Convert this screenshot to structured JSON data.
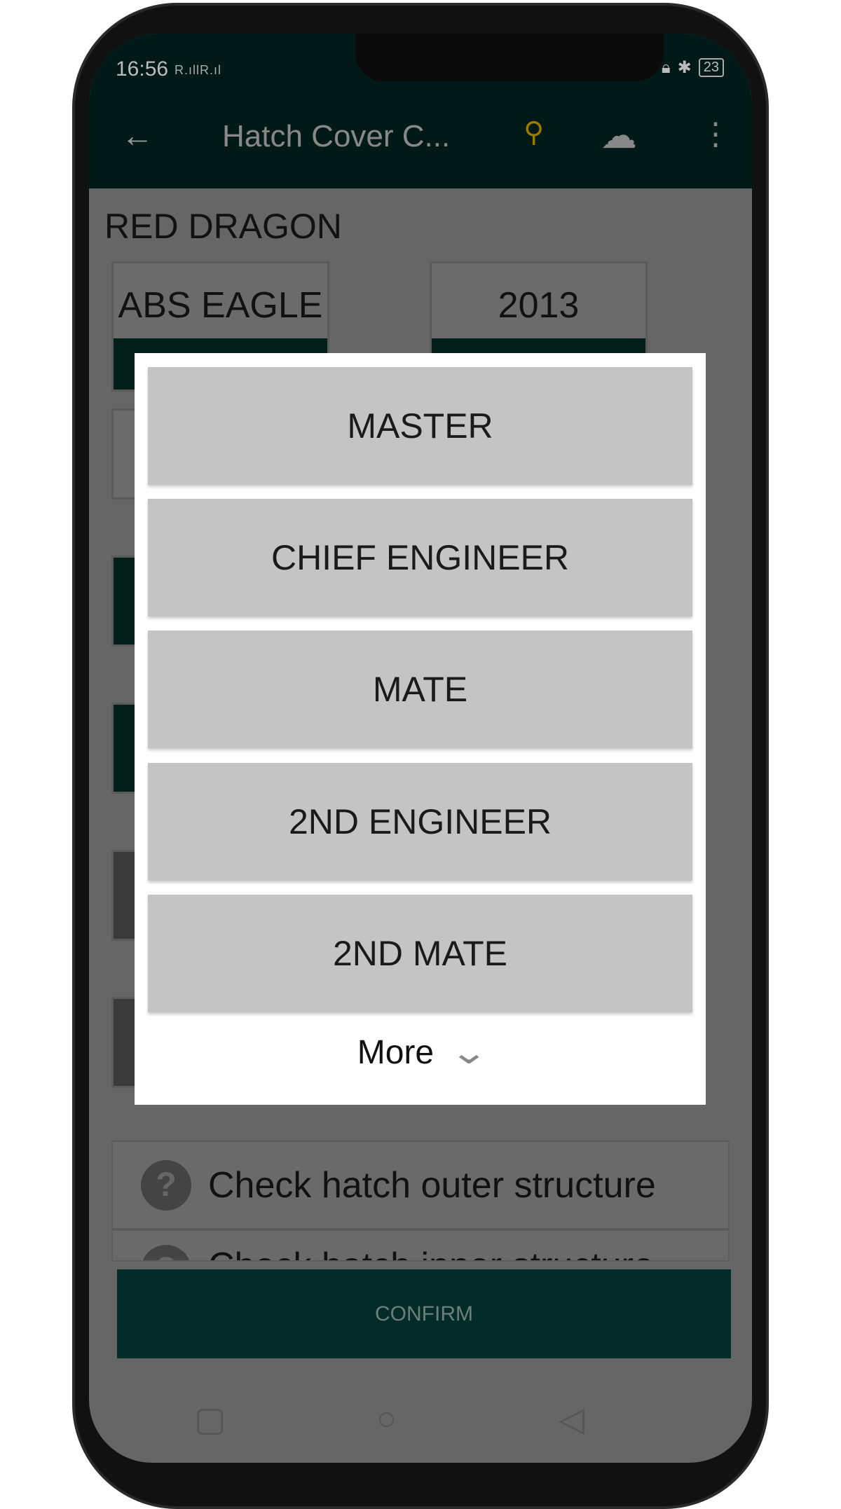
{
  "status_bar": {
    "time": "16:56",
    "signal": "R.ıllR.ıl",
    "battery": "23"
  },
  "toolbar": {
    "title": "Hatch Cover C...",
    "back_icon": "arrow-left-icon",
    "location_icon": "location-clock-icon",
    "cloud_icon": "cloud-check-icon",
    "menu_icon": "more-vert-icon"
  },
  "vessel_name": "RED DRAGON",
  "cards": [
    {
      "value": "ABS EAGLE"
    },
    {
      "value": "2013"
    }
  ],
  "checklist": [
    {
      "label": "Check hatch outer structure"
    },
    {
      "label": "Check hatch inner structure"
    }
  ],
  "confirm_label": "CONFIRM",
  "dialog": {
    "options": [
      "MASTER",
      "CHIEF ENGINEER",
      "MATE",
      "2ND ENGINEER",
      "2ND MATE"
    ],
    "more_label": "More"
  },
  "colors": {
    "header": "#021a17",
    "confirm": "#032c28",
    "pin": "#9a7b00"
  }
}
